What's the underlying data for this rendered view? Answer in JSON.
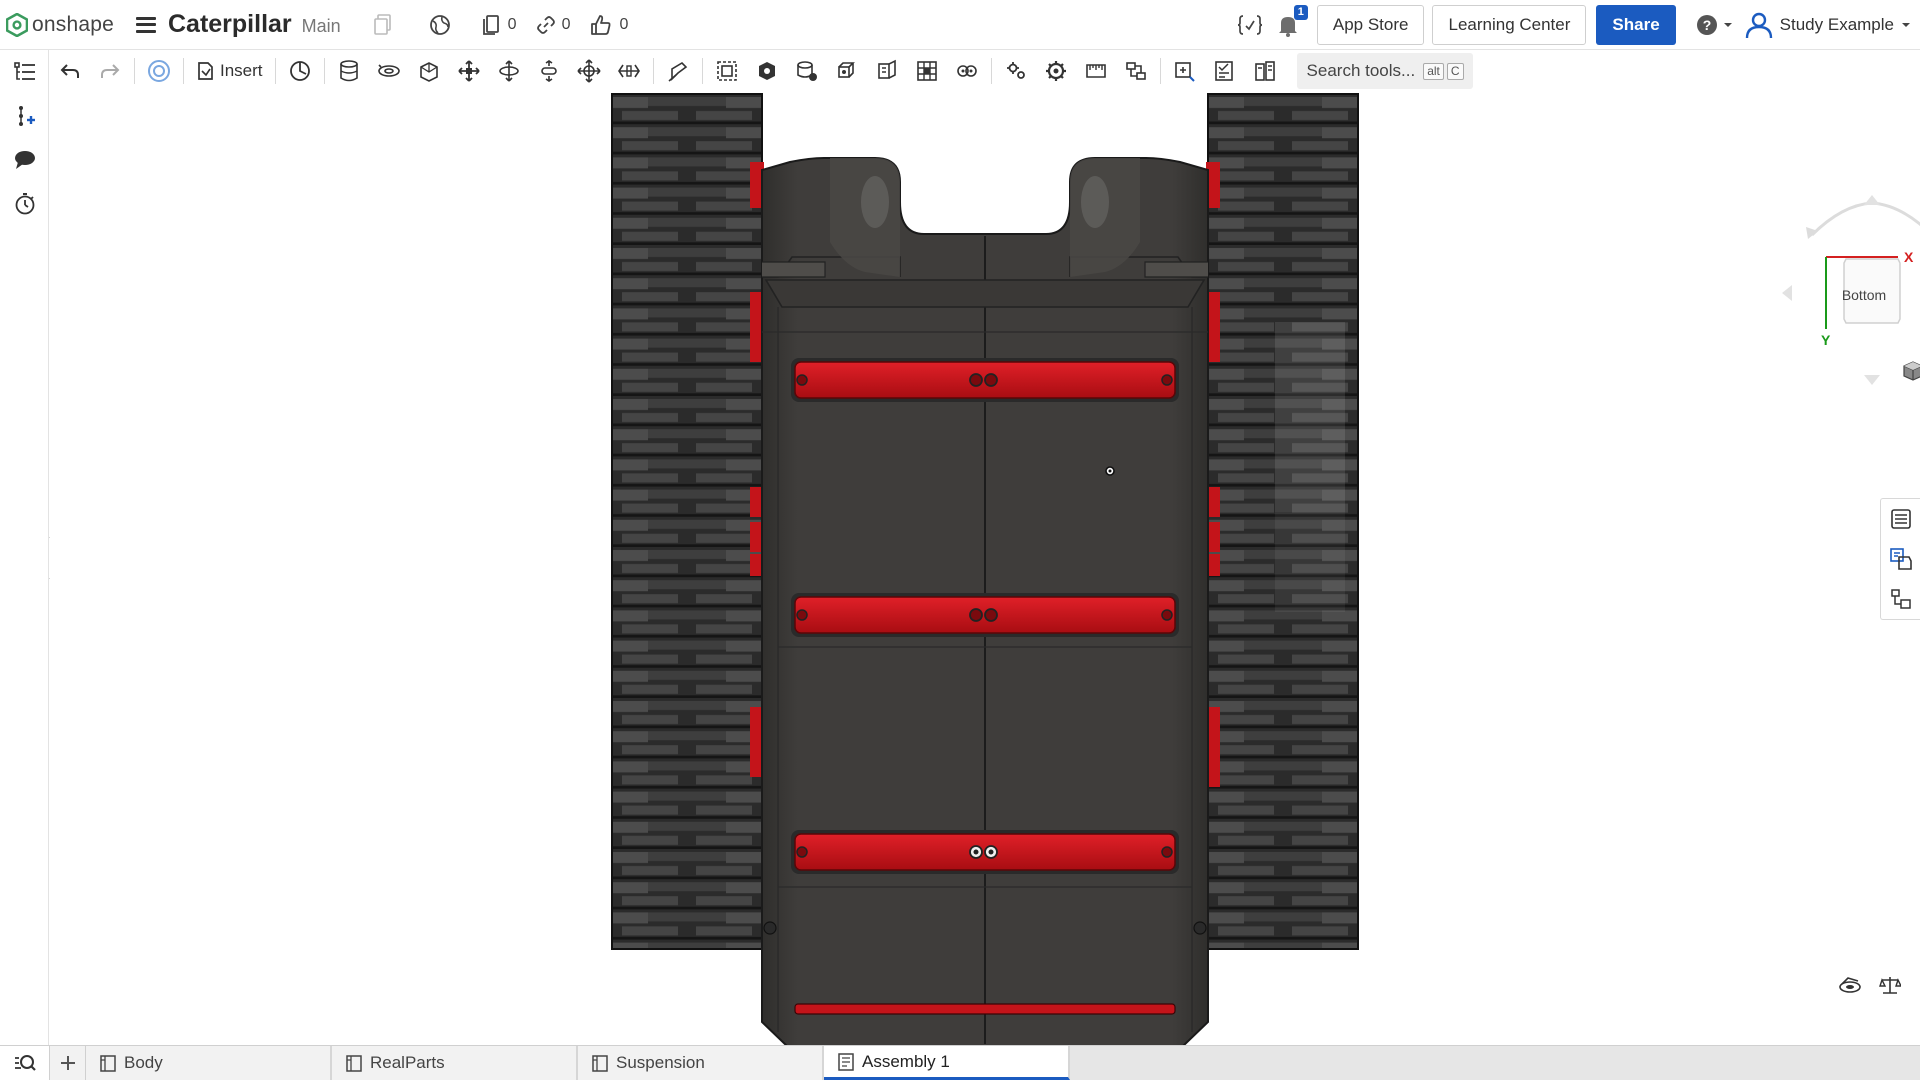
{
  "header": {
    "logo_text": "onshape",
    "doc_title": "Caterpillar",
    "branch": "Main",
    "counts": {
      "versions": "0",
      "links": "0",
      "likes": "0"
    },
    "notification_count": "1",
    "app_store_label": "App Store",
    "learning_center_label": "Learning Center",
    "share_label": "Share",
    "user_name": "Study Example"
  },
  "toolbar": {
    "insert_label": "Insert",
    "search_placeholder": "Search tools...",
    "shortcut_keys": [
      "alt",
      "C"
    ]
  },
  "view_cube": {
    "face": "Bottom",
    "axis_x": "X",
    "axis_y": "Y"
  },
  "tabs": [
    {
      "label": "Body",
      "active": false
    },
    {
      "label": "RealParts",
      "active": false
    },
    {
      "label": "Suspension",
      "active": false
    },
    {
      "label": "Assembly 1",
      "active": true
    }
  ],
  "colors": {
    "brand_blue": "#1b5bc0",
    "logo_green": "#3b9b5e",
    "body_dark": "#3d3b39",
    "track_dark": "#2c2c2c",
    "accent_red": "#c4141a",
    "axis_x": "#d42020",
    "axis_y": "#1a9a1a"
  }
}
